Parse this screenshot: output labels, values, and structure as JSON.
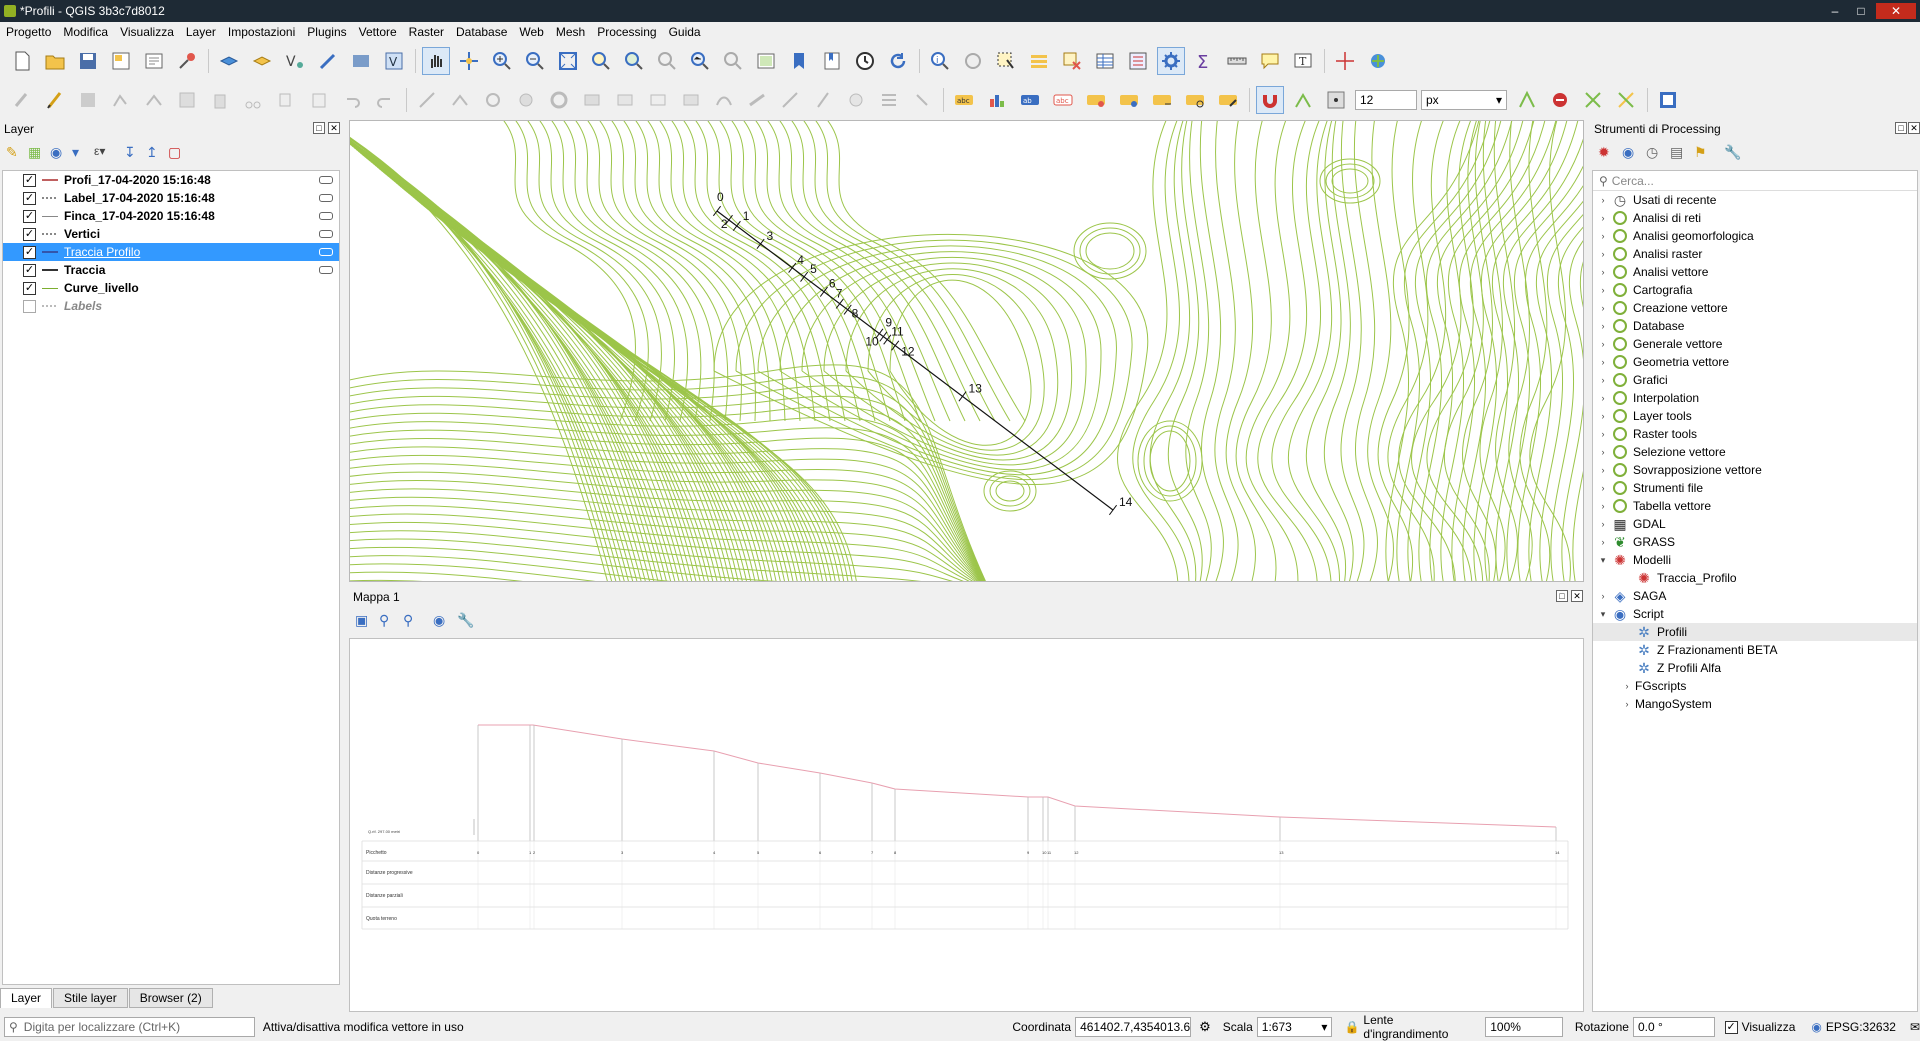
{
  "window": {
    "title": "*Profili - QGIS 3b3c7d8012"
  },
  "menu": [
    "Progetto",
    "Modifica",
    "Visualizza",
    "Layer",
    "Impostazioni",
    "Plugins",
    "Vettore",
    "Raster",
    "Database",
    "Web",
    "Mesh",
    "Processing",
    "Guida"
  ],
  "toolbar2": {
    "snap_tolerance": "12",
    "snap_unit": "px"
  },
  "layers_panel": {
    "title": "Layer",
    "layers": [
      {
        "name": "Profi_17-04-2020 15:16:48",
        "checked": true,
        "color": "#c06060"
      },
      {
        "name": "Label_17-04-2020 15:16:48",
        "checked": true,
        "color": "#888888"
      },
      {
        "name": "Finca_17-04-2020 15:16:48",
        "checked": true,
        "color": "#888888"
      },
      {
        "name": "Vertici",
        "checked": true,
        "color": "#888888"
      },
      {
        "name": "Traccia Profilo",
        "checked": true,
        "color": "#3355aa"
      },
      {
        "name": "Traccia",
        "checked": true,
        "color": "#333333"
      },
      {
        "name": "Curve_livello",
        "checked": true,
        "color": "#7cae2f"
      },
      {
        "name": "Labels",
        "checked": false,
        "color": "#888888"
      }
    ],
    "tabs": [
      "Layer",
      "Stile layer",
      "Browser (2)"
    ]
  },
  "map": {
    "vertex_labels": [
      "0",
      "1",
      "2",
      "3",
      "4",
      "5",
      "6",
      "7",
      "8",
      "9",
      "10",
      "11",
      "12",
      "13",
      "14"
    ]
  },
  "layout": {
    "title": "Mappa 1",
    "rows": [
      "Picchetto",
      "Distanze progressive",
      "Distanze parziali",
      "Quota terreno"
    ],
    "datum_label": "Q.rif. 297.00 metri"
  },
  "processing": {
    "title": "Strumenti di Processing",
    "search_placeholder": "Cerca...",
    "items": [
      {
        "label": "Usati di recente",
        "icon": "clock",
        "level": 0
      },
      {
        "label": "Analisi di reti",
        "icon": "q",
        "level": 0
      },
      {
        "label": "Analisi geomorfologica",
        "icon": "q",
        "level": 0
      },
      {
        "label": "Analisi raster",
        "icon": "q",
        "level": 0
      },
      {
        "label": "Analisi vettore",
        "icon": "q",
        "level": 0
      },
      {
        "label": "Cartografia",
        "icon": "q",
        "level": 0
      },
      {
        "label": "Creazione vettore",
        "icon": "q",
        "level": 0
      },
      {
        "label": "Database",
        "icon": "q",
        "level": 0
      },
      {
        "label": "Generale vettore",
        "icon": "q",
        "level": 0
      },
      {
        "label": "Geometria vettore",
        "icon": "q",
        "level": 0
      },
      {
        "label": "Grafici",
        "icon": "q",
        "level": 0
      },
      {
        "label": "Interpolation",
        "icon": "q",
        "level": 0
      },
      {
        "label": "Layer tools",
        "icon": "q",
        "level": 0
      },
      {
        "label": "Raster tools",
        "icon": "q",
        "level": 0
      },
      {
        "label": "Selezione vettore",
        "icon": "q",
        "level": 0
      },
      {
        "label": "Sovrapposizione vettore",
        "icon": "q",
        "level": 0
      },
      {
        "label": "Strumenti file",
        "icon": "q",
        "level": 0
      },
      {
        "label": "Tabella vettore",
        "icon": "q",
        "level": 0
      },
      {
        "label": "GDAL",
        "icon": "gdal",
        "level": 0
      },
      {
        "label": "GRASS",
        "icon": "grass",
        "level": 0
      },
      {
        "label": "Modelli",
        "icon": "model",
        "level": 0,
        "expanded": true
      },
      {
        "label": "Traccia_Profilo",
        "icon": "model",
        "level": 1
      },
      {
        "label": "SAGA",
        "icon": "saga",
        "level": 0
      },
      {
        "label": "Script",
        "icon": "python",
        "level": 0,
        "expanded": true
      },
      {
        "label": "Profili",
        "icon": "gear",
        "level": 1,
        "selected": true
      },
      {
        "label": "Z Frazionamenti BETA",
        "icon": "gear",
        "level": 1
      },
      {
        "label": "Z Profili Alfa",
        "icon": "gear",
        "level": 1
      },
      {
        "label": "FGscripts",
        "icon": "none",
        "level": 1
      },
      {
        "label": "MangoSystem",
        "icon": "none",
        "level": 1
      }
    ]
  },
  "status": {
    "locator_placeholder": "Digita per localizzare (Ctrl+K)",
    "message": "Attiva/disattiva modifica vettore in uso",
    "coord_label": "Coordinata",
    "coord_value": "461402.7,4354013.6",
    "scale_label": "Scala",
    "scale_value": "1:673",
    "magnifier_label": "Lente d'ingrandimento",
    "magnifier_value": "100%",
    "rotation_label": "Rotazione",
    "rotation_value": "0.0 °",
    "render_label": "Visualizza",
    "crs": "EPSG:32632"
  }
}
